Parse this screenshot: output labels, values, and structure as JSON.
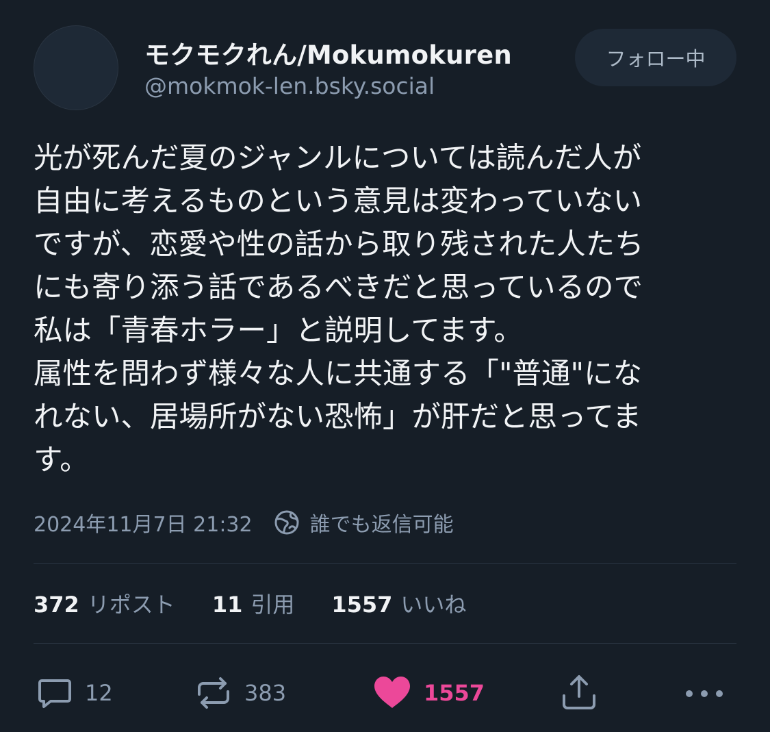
{
  "author": {
    "display_name": "モクモクれん/Mokumokuren",
    "handle": "@mokmok-len.bsky.social"
  },
  "follow_button": {
    "label": "フォロー中"
  },
  "post": {
    "text": "光が死んだ夏のジャンルについては読んだ人が\n自由に考えるものという意見は変わっていない\nですが、恋愛や性の話から取り残された人たち\nにも寄り添う話であるべきだと思っているので\n私は「青春ホラー」と説明してます。\n属性を問わず様々な人に共通する「\"普通\"にな\nれない、居場所がない恐怖」が肝だと思ってま\nす。",
    "timestamp": "2024年11月7日 21:32",
    "reply_setting": "誰でも返信可能"
  },
  "stats": {
    "reposts": {
      "count": "372",
      "label": "リポスト"
    },
    "quotes": {
      "count": "11",
      "label": "引用"
    },
    "likes": {
      "count": "1557",
      "label": "いいね"
    }
  },
  "actions": {
    "reply_count": "12",
    "repost_count": "383",
    "like_count": "1557",
    "like_color": "#ec4899",
    "icons": [
      "comment-icon",
      "repost-icon",
      "heart-icon",
      "share-icon",
      "more-icon"
    ]
  },
  "colors": {
    "background": "#161e27",
    "text": "#f1f3f5",
    "muted": "#8c9cb0",
    "button_bg": "#1e2936"
  }
}
